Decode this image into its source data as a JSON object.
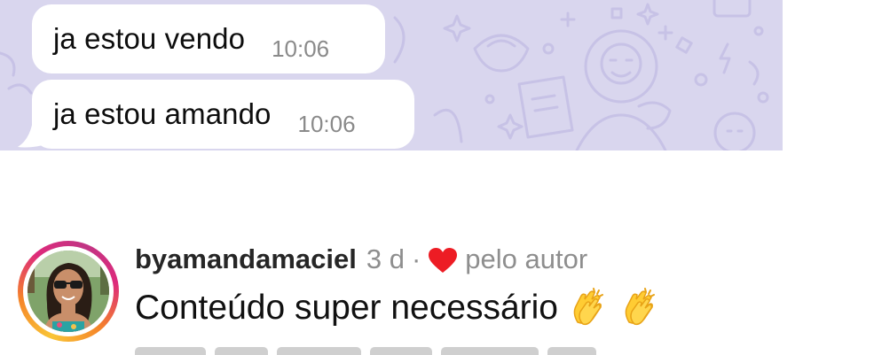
{
  "chat": {
    "messages": [
      {
        "text": "ja estou vendo",
        "time": "10:06"
      },
      {
        "text": "ja estou amando",
        "time": "10:06"
      }
    ],
    "wallpaper_color": "#d9d6ee",
    "bubble_color": "#ffffff"
  },
  "comment": {
    "avatar_icon": "user-avatar-photo",
    "username": "byamandamaciel",
    "age": "3 d",
    "separator": "·",
    "liked_by_author_icon": "heart-icon",
    "liked_by_author_label": "pelo autor",
    "text": "Conteúdo super necessário",
    "emojis": [
      "clapping-hands-emoji",
      "clapping-hands-emoji"
    ],
    "heart_color": "#ed1c24",
    "story_ring_colors": [
      "#f9c536",
      "#f58529",
      "#dd2a7b",
      "#c13584"
    ]
  }
}
